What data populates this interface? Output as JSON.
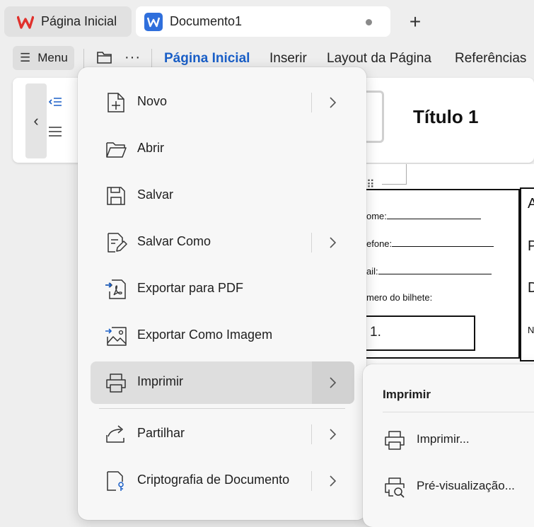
{
  "tabs": [
    {
      "label": "Página Inicial",
      "icon": "wps-logo-icon"
    },
    {
      "label": "Documento1",
      "icon": "writer-doc-icon"
    }
  ],
  "toolbar": {
    "menu_label": "Menu",
    "ribbon_tabs": [
      "Página Inicial",
      "Inserir",
      "Layout da Página",
      "Referências"
    ],
    "style_preview": "Título 1"
  },
  "document": {
    "fields": [
      "ome:",
      "efone:",
      "ail:",
      "mero do bilhete:"
    ],
    "answer": "1.",
    "right_letters": [
      "A",
      "P",
      "D",
      "N"
    ]
  },
  "main_menu": {
    "items": [
      {
        "label": "Novo",
        "icon": "new-file-icon",
        "has_submenu": true
      },
      {
        "label": "Abrir",
        "icon": "open-folder-icon",
        "has_submenu": false
      },
      {
        "label": "Salvar",
        "icon": "save-icon",
        "has_submenu": false
      },
      {
        "label": "Salvar Como",
        "icon": "save-as-icon",
        "has_submenu": true
      },
      {
        "label": "Exportar para PDF",
        "icon": "export-pdf-icon",
        "has_submenu": false
      },
      {
        "label": "Exportar Como Imagem",
        "icon": "export-image-icon",
        "has_submenu": false
      },
      {
        "label": "Imprimir",
        "icon": "printer-icon",
        "has_submenu": true,
        "selected": true
      },
      {
        "label": "Partilhar",
        "icon": "share-icon",
        "has_submenu": true
      },
      {
        "label": "Criptografia de Documento",
        "icon": "encrypt-document-icon",
        "has_submenu": true
      }
    ]
  },
  "sub_menu": {
    "title": "Imprimir",
    "items": [
      {
        "label": "Imprimir...",
        "icon": "printer-icon"
      },
      {
        "label": "Pré-visualização...",
        "icon": "print-preview-icon"
      }
    ]
  },
  "colors": {
    "accent": "#1a5fc7",
    "wps_red": "#e0312c",
    "writer_blue": "#2f6fdc",
    "selected_bg": "#dedede"
  }
}
